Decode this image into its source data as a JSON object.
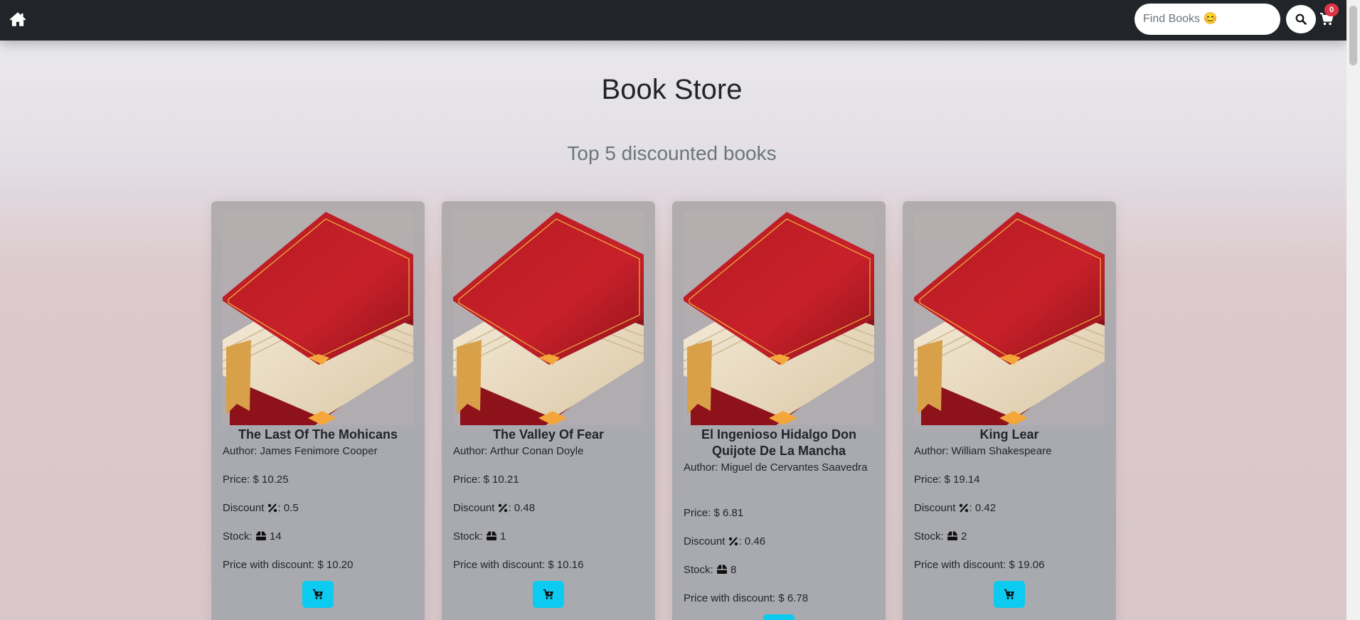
{
  "navbar": {
    "home_icon": "home-icon",
    "search_placeholder": "Find Books 😊",
    "search_value": "",
    "search_icon": "search-icon",
    "cart_icon": "cart-icon",
    "cart_count": "0"
  },
  "page": {
    "title": "Book Store",
    "section_title": "Top 5 discounted books"
  },
  "labels": {
    "author": "Author:",
    "price": "Price: $",
    "discount": "Discount",
    "stock": "Stock:",
    "price_with_discount": "Price with discount: $"
  },
  "books": [
    {
      "title": "The Last Of The Mohicans",
      "author": "James Fenimore Cooper",
      "price": "10.25",
      "discount": "0.5",
      "stock": "14",
      "price_with_discount": "10.20"
    },
    {
      "title": "The Valley Of Fear",
      "author": "Arthur Conan Doyle",
      "price": "10.21",
      "discount": "0.48",
      "stock": "1",
      "price_with_discount": "10.16"
    },
    {
      "title": "El Ingenioso Hidalgo Don Quijote De La Mancha",
      "author": "Miguel de Cervantes Saavedra",
      "price": "6.81",
      "discount": "0.46",
      "stock": "8",
      "price_with_discount": "6.78"
    },
    {
      "title": "King Lear",
      "author": "William Shakespeare",
      "price": "19.14",
      "discount": "0.42",
      "stock": "2",
      "price_with_discount": "19.06"
    }
  ],
  "colors": {
    "navbar": "#212529",
    "badge": "#dc3545",
    "add_button": "#0dcaf0",
    "card": "#aaaab0"
  }
}
